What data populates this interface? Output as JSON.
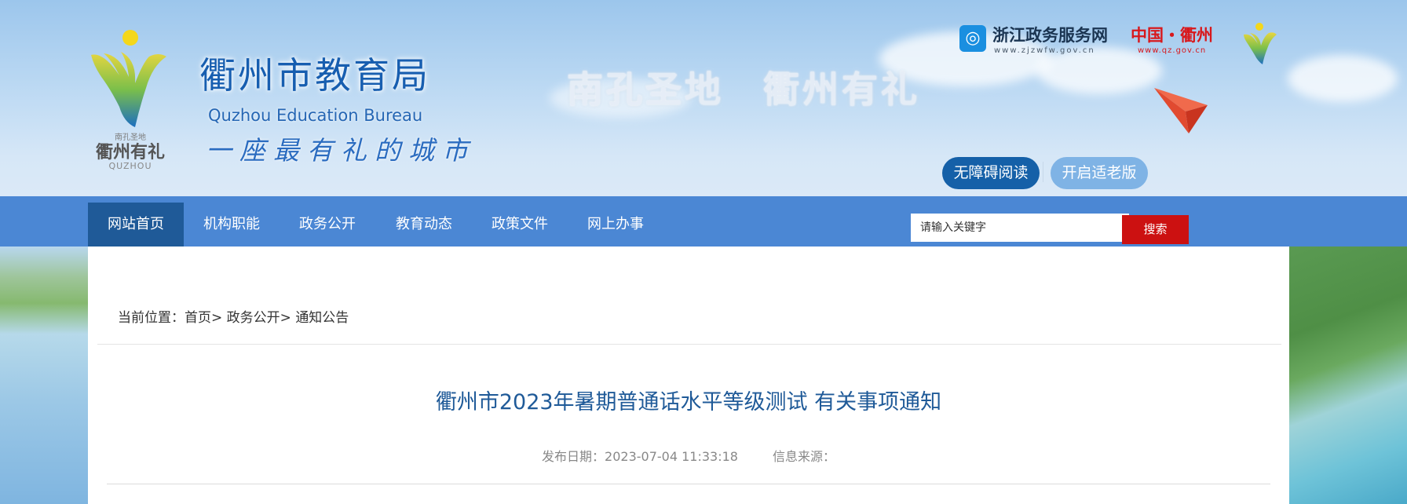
{
  "header": {
    "logo": {
      "tiny": "南孔圣地",
      "main": "衢州有礼",
      "en": "QUZHOU"
    },
    "site_title": "衢州市教育局",
    "site_title_en": "Quzhou Education Bureau",
    "slogan": "一座最有礼的城市",
    "city_motto": "南孔圣地　衢州有礼",
    "links": {
      "zjzwfw_name": "浙江政务服务网",
      "zjzwfw_url": "www.zjzwfw.gov.cn",
      "qz_name": "中国・衢州",
      "qz_url": "www.qz.gov.cn"
    },
    "buttons": {
      "accessible": "无障碍阅读",
      "elder": "开启适老版"
    }
  },
  "nav": {
    "items": [
      {
        "label": "网站首页",
        "active": true
      },
      {
        "label": "机构职能",
        "active": false
      },
      {
        "label": "政务公开",
        "active": false
      },
      {
        "label": "教育动态",
        "active": false
      },
      {
        "label": "政策文件",
        "active": false
      },
      {
        "label": "网上办事",
        "active": false
      }
    ],
    "search_placeholder": "请输入关键字",
    "search_button": "搜索"
  },
  "breadcrumb": {
    "prefix": "当前位置：",
    "items": [
      "首页",
      "政务公开",
      "通知公告"
    ],
    "separator": "> "
  },
  "article": {
    "title": "衢州市2023年暑期普通话水平等级测试 有关事项通知",
    "publish_label": "发布日期：",
    "publish_date": "2023-07-04 11:33:18",
    "source_label": "信息来源："
  },
  "colors": {
    "nav_bg": "#4b87d4",
    "nav_active": "#1f5a98",
    "search_btn": "#cc1111",
    "title_blue": "#1f5a98",
    "accessible_btn": "#1560a8",
    "elder_btn": "#7fb3e5"
  },
  "icons": [
    "zjzwfw-logo-icon",
    "city-logo-icon",
    "paper-plane-icon",
    "brand-logo-icon"
  ]
}
